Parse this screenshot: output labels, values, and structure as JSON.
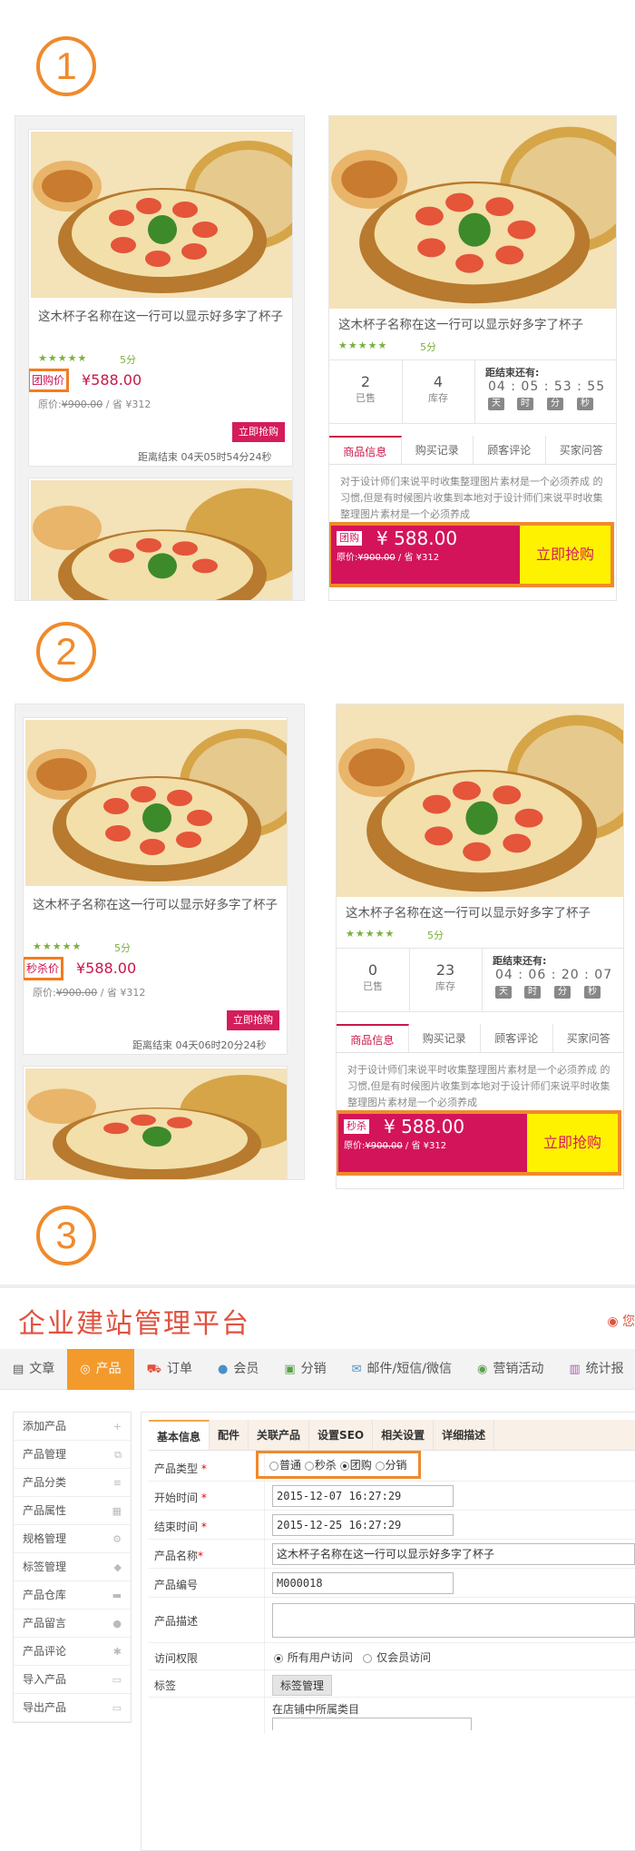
{
  "steps": {
    "s1": "1",
    "s2": "2",
    "s3": "3"
  },
  "product": {
    "title": "这木杯子名称在这一行可以显示好多字了杯子",
    "stars": "★★★★★",
    "score": "5分",
    "price": "¥588.00",
    "orig_label": "原价:",
    "orig_price": "¥900.00",
    "save": "/  省 ¥312",
    "buy_btn": "立即抢购"
  },
  "variant1": {
    "tag": "团购价",
    "countdown": "距离结束 04天05时54分24秒",
    "sold": "2",
    "sold_label": "已售",
    "stock": "4",
    "stock_label": "库存",
    "cd_label": "距结束还有:",
    "cd_nums": "04 : 05 : 53 : 55",
    "bar_tag": "团购",
    "bar_price": "¥ 588.00",
    "bar_orig_label": "原价:",
    "bar_orig": "¥900.00",
    "bar_save": "/  省 ¥312",
    "bar_btn": "立即抢购"
  },
  "variant2": {
    "tag": "秒杀价",
    "countdown": "距离结束 04天06时20分24秒",
    "sold": "0",
    "sold_label": "已售",
    "stock": "23",
    "stock_label": "库存",
    "cd_label": "距结束还有:",
    "cd_nums": "04 : 06 : 20 : 07",
    "bar_tag": "秒杀",
    "bar_price": "¥ 588.00",
    "bar_orig_label": "原价:",
    "bar_orig": "¥900.00",
    "bar_save": "/  省 ¥312",
    "bar_btn": "立即抢购"
  },
  "cd_units": {
    "d": "天",
    "h": "时",
    "m": "分",
    "s": "秒"
  },
  "detail_tabs": [
    "商品信息",
    "购买记录",
    "顾客评论",
    "买家问答"
  ],
  "desc": "对于设计师们来说平时收集整理图片素材是一个必须养成 的习惯,但是有时候图片收集到本地对于设计师们来说平时收集整理图片素材是一个必须养成",
  "admin": {
    "logo": "企业建站管理平台",
    "user_icon": "user-circle-icon",
    "user_text": "您",
    "nav": [
      {
        "icon": "▤",
        "label": "文章"
      },
      {
        "icon": "◎",
        "label": "产品"
      },
      {
        "icon": "⛟",
        "label": "订单"
      },
      {
        "icon": "●",
        "label": "会员"
      },
      {
        "icon": "▣",
        "label": "分销"
      },
      {
        "icon": "✉",
        "label": "邮件/短信/微信"
      },
      {
        "icon": "◉",
        "label": "营销活动"
      },
      {
        "icon": "▥",
        "label": "统计报"
      }
    ],
    "side": [
      {
        "label": "添加产品",
        "icon": "+"
      },
      {
        "label": "产品管理",
        "icon": "⧉"
      },
      {
        "label": "产品分类",
        "icon": "≡"
      },
      {
        "label": "产品属性",
        "icon": "▦"
      },
      {
        "label": "规格管理",
        "icon": "⚙"
      },
      {
        "label": "标签管理",
        "icon": "◆"
      },
      {
        "label": "产品仓库",
        "icon": "▬"
      },
      {
        "label": "产品留言",
        "icon": "●"
      },
      {
        "label": "产品评论",
        "icon": "✱"
      },
      {
        "label": "导入产品",
        "icon": "▭"
      },
      {
        "label": "导出产品",
        "icon": "▭"
      }
    ],
    "tabs": [
      "基本信息",
      "配件",
      "关联产品",
      "设置SEO",
      "相关设置",
      "详细描述"
    ],
    "fields": {
      "type_label": "产品类型",
      "type_options": [
        "普通",
        "秒杀",
        "团购",
        "分销"
      ],
      "start_label": "开始时间",
      "start_value": "2015-12-07 16:27:29",
      "end_label": "结束时间",
      "end_value": "2015-12-25 16:27:29",
      "name_label": "产品名称",
      "name_value": "这木杯子名称在这一行可以显示好多字了杯子",
      "code_label": "产品编号",
      "code_value": "M000018",
      "desc_label": "产品描述",
      "access_label": "访问权限",
      "access_all": "所有用户访问",
      "access_member": "仅会员访问",
      "tag_label": "标签",
      "tag_btn": "标签管理",
      "category_text": "在店铺中所属类目"
    }
  }
}
